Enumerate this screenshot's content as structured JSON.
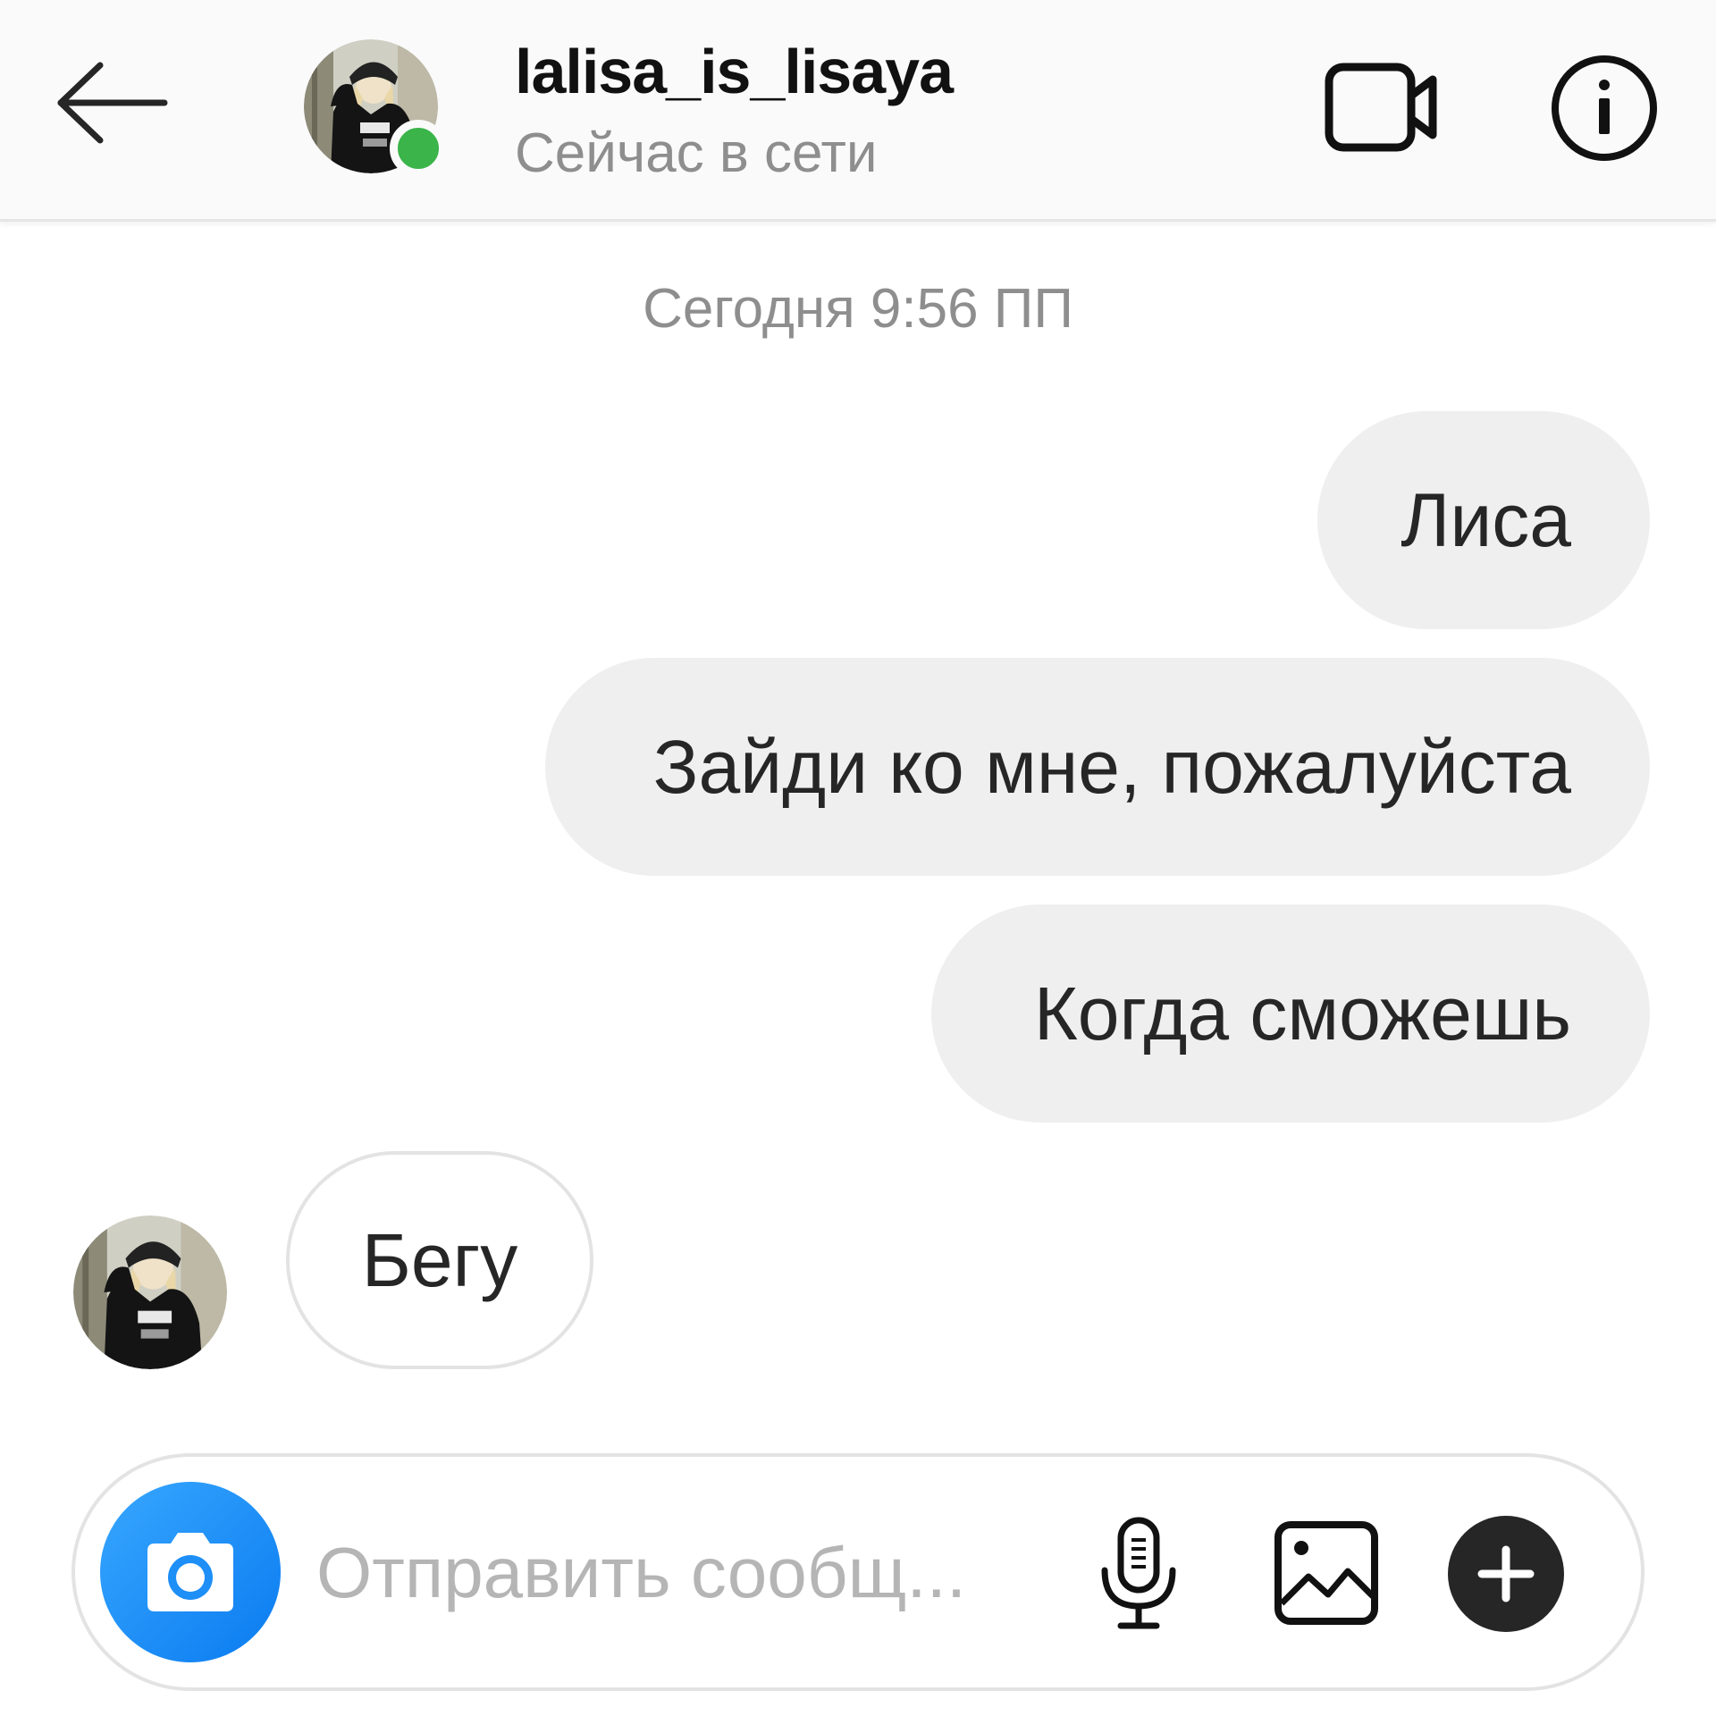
{
  "header": {
    "back_icon": "arrow-left-icon",
    "username": "lalisa_is_lisaya",
    "status": "Сейчас в сети",
    "video_icon": "video-camera-icon",
    "info_icon": "info-icon",
    "online_color": "#3bb44a"
  },
  "chat": {
    "timestamp": "Сегодня 9:56 ПП",
    "messages": [
      {
        "direction": "outgoing",
        "text": "Лиса"
      },
      {
        "direction": "outgoing",
        "text": "Зайди ко мне, пожалуйста"
      },
      {
        "direction": "outgoing",
        "text": "Когда сможешь"
      },
      {
        "direction": "incoming",
        "text": "Бегу"
      }
    ]
  },
  "composer": {
    "camera_icon": "camera-icon",
    "placeholder": "Отправить сообщ...",
    "mic_icon": "microphone-icon",
    "gallery_icon": "image-icon",
    "plus_icon": "plus-icon",
    "camera_color": "#1d8ff7"
  }
}
